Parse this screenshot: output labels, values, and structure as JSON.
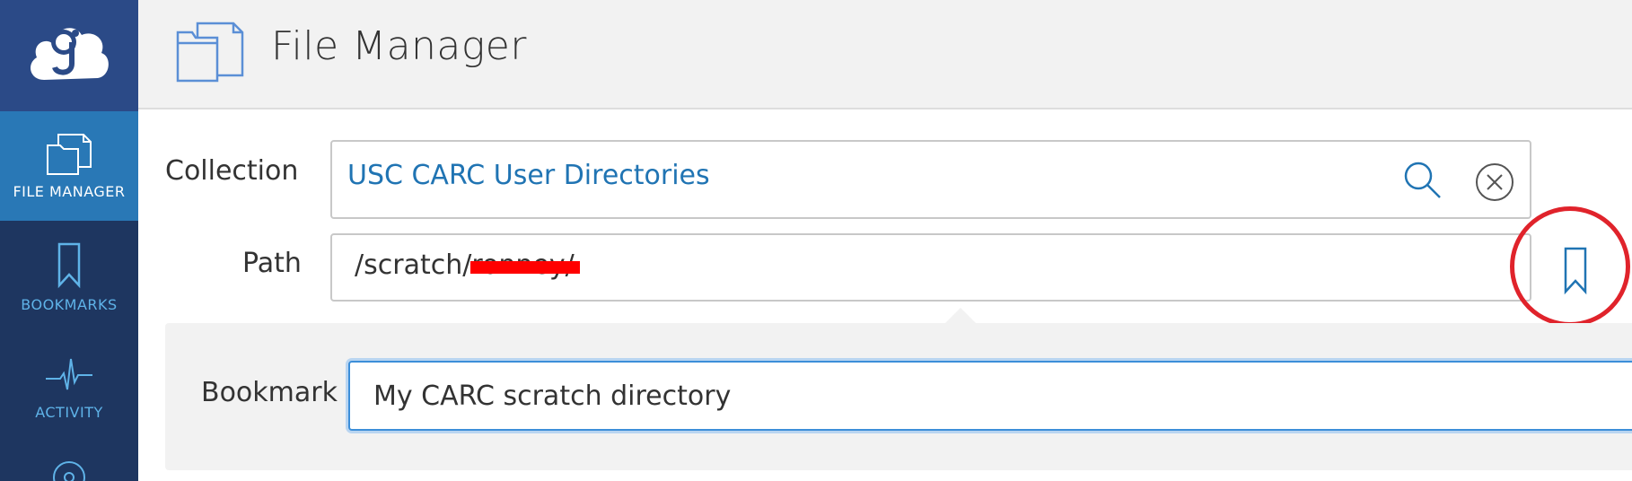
{
  "app": {
    "logo_icon": "globus-cloud-icon"
  },
  "sidebar": {
    "items": [
      {
        "label": "FILE MANAGER",
        "icon": "folders-icon",
        "active": true
      },
      {
        "label": "BOOKMARKS",
        "icon": "bookmark-icon",
        "active": false
      },
      {
        "label": "ACTIVITY",
        "icon": "activity-pulse-icon",
        "active": false
      }
    ],
    "colors": {
      "background": "#1e3660",
      "active": "#2978b6",
      "logo_bg": "#2b4a87",
      "label": "#5fb3e8"
    }
  },
  "header": {
    "title": "File Manager",
    "icon": "folders-icon"
  },
  "form": {
    "collection_label": "Collection",
    "collection_value": "USC CARC User Directories",
    "path_label": "Path",
    "path_value": "/scratch/",
    "path_redacted_suffix": "ronney/",
    "bookmark_label": "Bookmark",
    "bookmark_value": "My CARC scratch directory"
  },
  "icons": {
    "search": "search-icon",
    "clear": "clear-circle-x-icon",
    "bookmark_toggle": "bookmark-icon"
  },
  "colors": {
    "link": "#2074b3",
    "highlight_circle": "#e0232b",
    "redaction": "#ff0000",
    "input_focus": "#3c8ed9"
  }
}
